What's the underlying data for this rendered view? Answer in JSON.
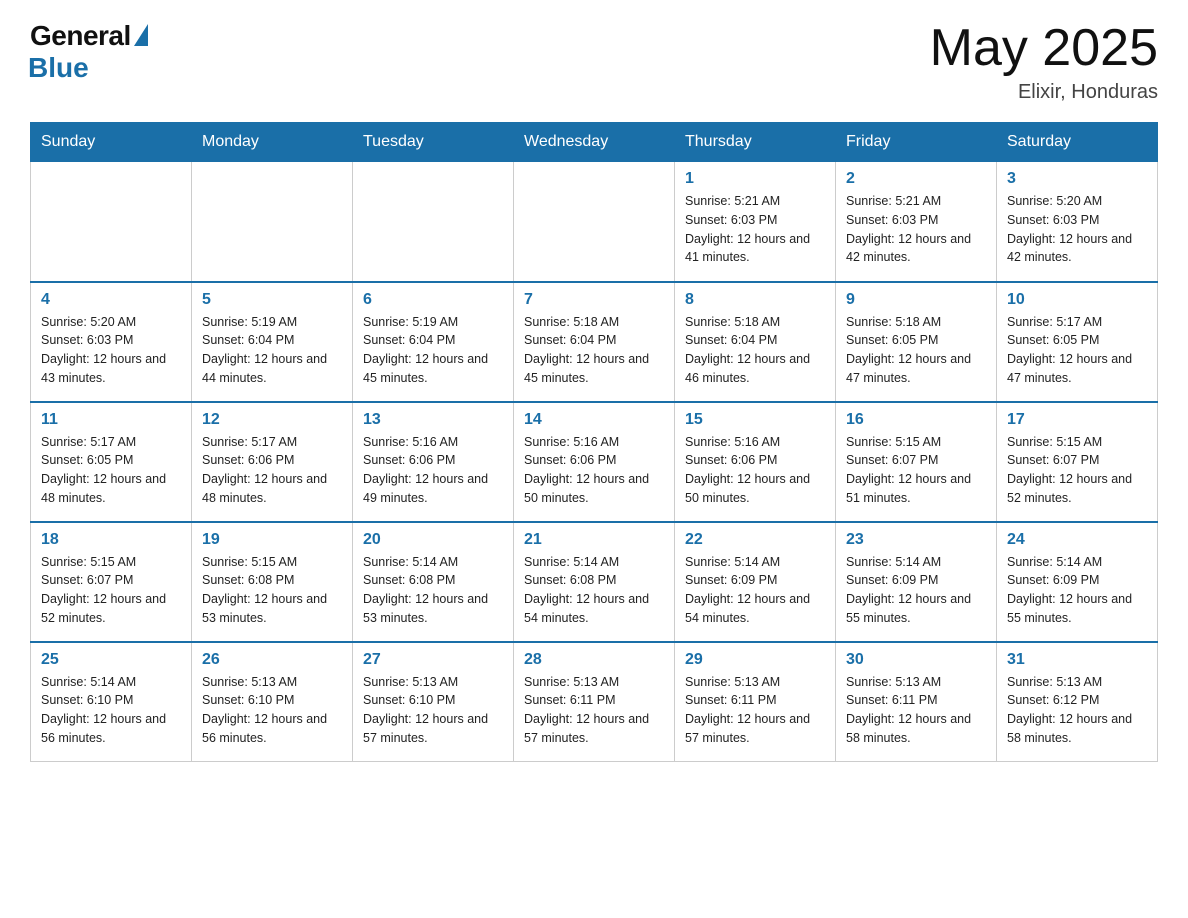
{
  "header": {
    "logo_general": "General",
    "logo_blue": "Blue",
    "month_title": "May 2025",
    "location": "Elixir, Honduras"
  },
  "days_of_week": [
    "Sunday",
    "Monday",
    "Tuesday",
    "Wednesday",
    "Thursday",
    "Friday",
    "Saturday"
  ],
  "weeks": [
    [
      {
        "day": "",
        "info": ""
      },
      {
        "day": "",
        "info": ""
      },
      {
        "day": "",
        "info": ""
      },
      {
        "day": "",
        "info": ""
      },
      {
        "day": "1",
        "info": "Sunrise: 5:21 AM\nSunset: 6:03 PM\nDaylight: 12 hours\nand 41 minutes."
      },
      {
        "day": "2",
        "info": "Sunrise: 5:21 AM\nSunset: 6:03 PM\nDaylight: 12 hours\nand 42 minutes."
      },
      {
        "day": "3",
        "info": "Sunrise: 5:20 AM\nSunset: 6:03 PM\nDaylight: 12 hours\nand 42 minutes."
      }
    ],
    [
      {
        "day": "4",
        "info": "Sunrise: 5:20 AM\nSunset: 6:03 PM\nDaylight: 12 hours\nand 43 minutes."
      },
      {
        "day": "5",
        "info": "Sunrise: 5:19 AM\nSunset: 6:04 PM\nDaylight: 12 hours\nand 44 minutes."
      },
      {
        "day": "6",
        "info": "Sunrise: 5:19 AM\nSunset: 6:04 PM\nDaylight: 12 hours\nand 45 minutes."
      },
      {
        "day": "7",
        "info": "Sunrise: 5:18 AM\nSunset: 6:04 PM\nDaylight: 12 hours\nand 45 minutes."
      },
      {
        "day": "8",
        "info": "Sunrise: 5:18 AM\nSunset: 6:04 PM\nDaylight: 12 hours\nand 46 minutes."
      },
      {
        "day": "9",
        "info": "Sunrise: 5:18 AM\nSunset: 6:05 PM\nDaylight: 12 hours\nand 47 minutes."
      },
      {
        "day": "10",
        "info": "Sunrise: 5:17 AM\nSunset: 6:05 PM\nDaylight: 12 hours\nand 47 minutes."
      }
    ],
    [
      {
        "day": "11",
        "info": "Sunrise: 5:17 AM\nSunset: 6:05 PM\nDaylight: 12 hours\nand 48 minutes."
      },
      {
        "day": "12",
        "info": "Sunrise: 5:17 AM\nSunset: 6:06 PM\nDaylight: 12 hours\nand 48 minutes."
      },
      {
        "day": "13",
        "info": "Sunrise: 5:16 AM\nSunset: 6:06 PM\nDaylight: 12 hours\nand 49 minutes."
      },
      {
        "day": "14",
        "info": "Sunrise: 5:16 AM\nSunset: 6:06 PM\nDaylight: 12 hours\nand 50 minutes."
      },
      {
        "day": "15",
        "info": "Sunrise: 5:16 AM\nSunset: 6:06 PM\nDaylight: 12 hours\nand 50 minutes."
      },
      {
        "day": "16",
        "info": "Sunrise: 5:15 AM\nSunset: 6:07 PM\nDaylight: 12 hours\nand 51 minutes."
      },
      {
        "day": "17",
        "info": "Sunrise: 5:15 AM\nSunset: 6:07 PM\nDaylight: 12 hours\nand 52 minutes."
      }
    ],
    [
      {
        "day": "18",
        "info": "Sunrise: 5:15 AM\nSunset: 6:07 PM\nDaylight: 12 hours\nand 52 minutes."
      },
      {
        "day": "19",
        "info": "Sunrise: 5:15 AM\nSunset: 6:08 PM\nDaylight: 12 hours\nand 53 minutes."
      },
      {
        "day": "20",
        "info": "Sunrise: 5:14 AM\nSunset: 6:08 PM\nDaylight: 12 hours\nand 53 minutes."
      },
      {
        "day": "21",
        "info": "Sunrise: 5:14 AM\nSunset: 6:08 PM\nDaylight: 12 hours\nand 54 minutes."
      },
      {
        "day": "22",
        "info": "Sunrise: 5:14 AM\nSunset: 6:09 PM\nDaylight: 12 hours\nand 54 minutes."
      },
      {
        "day": "23",
        "info": "Sunrise: 5:14 AM\nSunset: 6:09 PM\nDaylight: 12 hours\nand 55 minutes."
      },
      {
        "day": "24",
        "info": "Sunrise: 5:14 AM\nSunset: 6:09 PM\nDaylight: 12 hours\nand 55 minutes."
      }
    ],
    [
      {
        "day": "25",
        "info": "Sunrise: 5:14 AM\nSunset: 6:10 PM\nDaylight: 12 hours\nand 56 minutes."
      },
      {
        "day": "26",
        "info": "Sunrise: 5:13 AM\nSunset: 6:10 PM\nDaylight: 12 hours\nand 56 minutes."
      },
      {
        "day": "27",
        "info": "Sunrise: 5:13 AM\nSunset: 6:10 PM\nDaylight: 12 hours\nand 57 minutes."
      },
      {
        "day": "28",
        "info": "Sunrise: 5:13 AM\nSunset: 6:11 PM\nDaylight: 12 hours\nand 57 minutes."
      },
      {
        "day": "29",
        "info": "Sunrise: 5:13 AM\nSunset: 6:11 PM\nDaylight: 12 hours\nand 57 minutes."
      },
      {
        "day": "30",
        "info": "Sunrise: 5:13 AM\nSunset: 6:11 PM\nDaylight: 12 hours\nand 58 minutes."
      },
      {
        "day": "31",
        "info": "Sunrise: 5:13 AM\nSunset: 6:12 PM\nDaylight: 12 hours\nand 58 minutes."
      }
    ]
  ]
}
